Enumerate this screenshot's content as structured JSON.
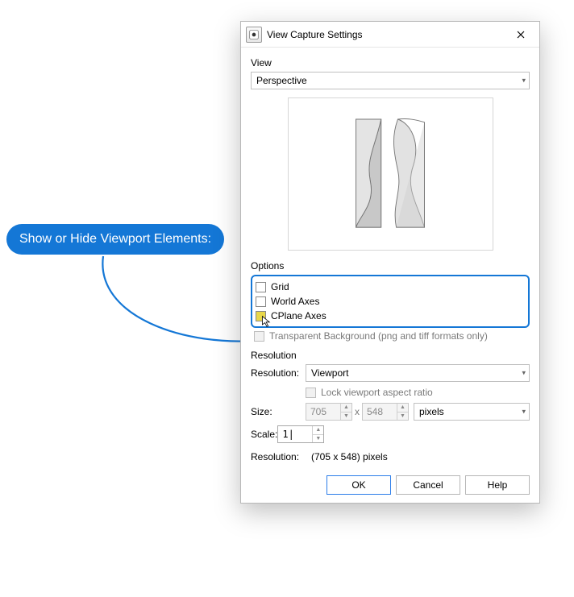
{
  "dialog": {
    "title": "View Capture Settings"
  },
  "view": {
    "group_label": "View",
    "selected": "Perspective"
  },
  "options": {
    "group_label": "Options",
    "grid_label": "Grid",
    "world_axes_label": "World Axes",
    "cplane_axes_label": "CPlane Axes",
    "transparent_label": "Transparent Background (png and tiff formats only)"
  },
  "resolution": {
    "group_label": "Resolution",
    "res_label": "Resolution:",
    "res_selected": "Viewport",
    "lock_label": "Lock viewport aspect ratio",
    "size_label": "Size:",
    "width_value": "705",
    "height_value": "548",
    "units_selected": "pixels",
    "x_sep": "x",
    "scale_label": "Scale:",
    "scale_value": "1",
    "readout_label": "Resolution:",
    "readout_value": "(705 x 548) pixels"
  },
  "buttons": {
    "ok": "OK",
    "cancel": "Cancel",
    "help": "Help"
  },
  "callout": {
    "text": "Show or Hide Viewport Elements:"
  }
}
